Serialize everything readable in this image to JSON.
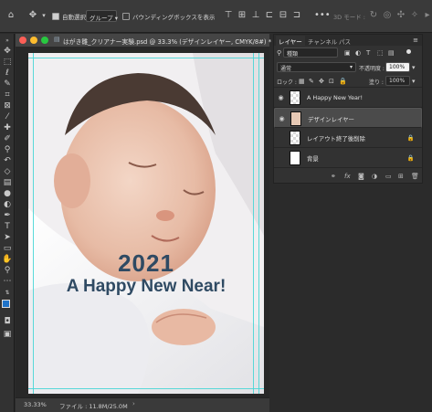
{
  "options_bar": {
    "auto_select_label": "自動選択 :",
    "auto_select_checked": true,
    "auto_select_target": "グループ",
    "bounding_box_label": "バウンディングボックスを表示",
    "bounding_box_checked": false,
    "mode_3d_label": "3D モード :"
  },
  "document": {
    "title": "はがき雛_クリアナー実験.psd @ 33.3% (デザインレイヤー, CMYK/8#) *",
    "zoom": "33.33%",
    "file_info": "ファイル : 11.8M/25.0M",
    "year_text": "2021",
    "greeting_text": "A Happy New Near!",
    "text_color": "#2f4a63"
  },
  "layers_panel": {
    "tabs": [
      "レイヤー",
      "チャンネル",
      "パス"
    ],
    "active_tab": 0,
    "kind_filter": "種類",
    "blend_mode": "通常",
    "opacity_label": "不透明度 :",
    "opacity_value": "100%",
    "lock_label": "ロック :",
    "fill_label": "塗り :",
    "fill_value": "100%",
    "layers": [
      {
        "name": "A Happy New Year!",
        "visible": true,
        "selected": false,
        "locked": false,
        "thumb": "checker"
      },
      {
        "name": "デザインレイヤー",
        "visible": true,
        "selected": true,
        "locked": false,
        "thumb": "photo"
      },
      {
        "name": "レイアウト終了後削除",
        "visible": false,
        "selected": false,
        "locked": true,
        "thumb": "checker"
      },
      {
        "name": "背景",
        "visible": false,
        "selected": false,
        "locked": true,
        "thumb": "white"
      }
    ]
  },
  "colors": {
    "foreground": "#1f73c9",
    "background": "#ffffff",
    "guide": "#48d6d6"
  }
}
